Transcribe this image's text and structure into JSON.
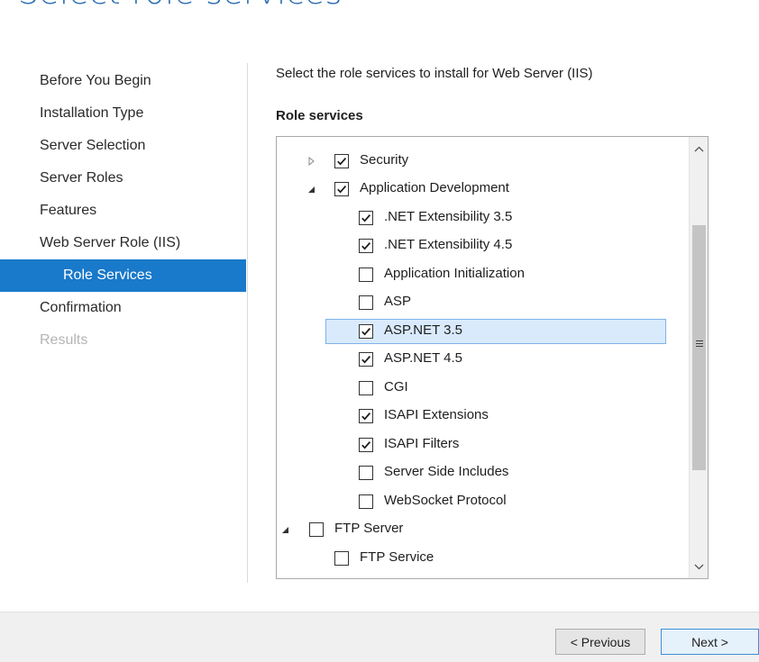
{
  "page": {
    "title": "Select role services"
  },
  "nav": {
    "items": [
      {
        "label": "Before You Begin",
        "state": "normal"
      },
      {
        "label": "Installation Type",
        "state": "normal"
      },
      {
        "label": "Server Selection",
        "state": "normal"
      },
      {
        "label": "Server Roles",
        "state": "normal"
      },
      {
        "label": "Features",
        "state": "normal"
      },
      {
        "label": "Web Server Role (IIS)",
        "state": "normal"
      },
      {
        "label": "Role Services",
        "state": "active"
      },
      {
        "label": "Confirmation",
        "state": "normal"
      },
      {
        "label": "Results",
        "state": "disabled"
      }
    ]
  },
  "main": {
    "intro": "Select the role services to install for Web Server (IIS)",
    "section_label": "Role services",
    "tree": [
      {
        "label": "Security",
        "checked": true,
        "expander": "collapsed"
      },
      {
        "label": "Application Development",
        "checked": true,
        "expander": "expanded"
      },
      {
        "label": ".NET Extensibility 3.5",
        "checked": true
      },
      {
        "label": ".NET Extensibility 4.5",
        "checked": true
      },
      {
        "label": "Application Initialization",
        "checked": false
      },
      {
        "label": "ASP",
        "checked": false
      },
      {
        "label": "ASP.NET 3.5",
        "checked": true,
        "selected": true
      },
      {
        "label": "ASP.NET 4.5",
        "checked": true
      },
      {
        "label": "CGI",
        "checked": false
      },
      {
        "label": "ISAPI Extensions",
        "checked": true
      },
      {
        "label": "ISAPI Filters",
        "checked": true
      },
      {
        "label": "Server Side Includes",
        "checked": false
      },
      {
        "label": "WebSocket Protocol",
        "checked": false
      },
      {
        "label": "FTP Server",
        "checked": false,
        "expander": "expanded"
      },
      {
        "label": "FTP Service",
        "checked": false
      }
    ]
  },
  "footer": {
    "previous_label": "< Previous",
    "next_label": "Next >"
  },
  "colors": {
    "accent": "#1979ca",
    "title": "#2b6cb0",
    "selection": "#d9eafc"
  }
}
